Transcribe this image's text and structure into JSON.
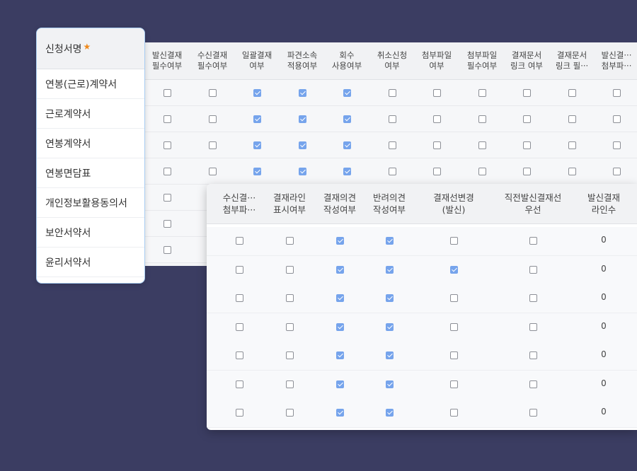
{
  "name_list": {
    "header": "신청서명",
    "required_mark": "★",
    "items": [
      "연봉(근로)계약서",
      "근로계약서",
      "연봉계약서",
      "연봉면담표",
      "개인정보활용동의서",
      "보안서약서",
      "윤리서약서"
    ]
  },
  "back_table": {
    "columns": [
      "발신결재\n필수여부",
      "수신결재\n필수여부",
      "일괄결재\n여부",
      "파견소속\n적용여부",
      "회수\n사용여부",
      "취소신청\n여부",
      "첨부파일\n여부",
      "첨부파일\n필수여부",
      "결재문서\n링크 여부",
      "결재문서\n링크 필···",
      "발신결···\n첨부파···"
    ],
    "rows": [
      [
        false,
        false,
        true,
        true,
        true,
        false,
        false,
        false,
        false,
        false,
        false
      ],
      [
        false,
        false,
        true,
        true,
        true,
        false,
        false,
        false,
        false,
        false,
        false
      ],
      [
        false,
        false,
        true,
        true,
        true,
        false,
        false,
        false,
        false,
        false,
        false
      ],
      [
        false,
        false,
        true,
        true,
        true,
        false,
        false,
        false,
        false,
        false,
        false
      ],
      [
        false
      ],
      [
        false
      ],
      [
        false
      ]
    ]
  },
  "front_table": {
    "columns": [
      "수신결···\n첨부파···",
      "결재라인\n표시여부",
      "결재의견\n작성여부",
      "반려의견\n작성여부",
      "결재선변경\n(발신)",
      "직전발신결재선\n우선",
      "발신결재\n라인수"
    ],
    "rows": [
      {
        "checks": [
          false,
          false,
          true,
          true,
          false,
          false
        ],
        "count": "0"
      },
      {
        "checks": [
          false,
          false,
          true,
          true,
          true,
          false
        ],
        "count": "0"
      },
      {
        "checks": [
          false,
          false,
          true,
          true,
          false,
          false
        ],
        "count": "0"
      },
      {
        "checks": [
          false,
          false,
          true,
          true,
          false,
          false
        ],
        "count": "0"
      },
      {
        "checks": [
          false,
          false,
          true,
          true,
          false,
          false
        ],
        "count": "0"
      },
      {
        "checks": [
          false,
          false,
          true,
          true,
          false,
          false
        ],
        "count": "0"
      },
      {
        "checks": [
          false,
          false,
          true,
          true,
          false,
          false
        ],
        "count": "0"
      }
    ]
  },
  "colors": {
    "background": "#3b3d62",
    "checked": "#76a4ec",
    "required_star": "#f08a1c",
    "list_border": "#a9cdf2"
  }
}
